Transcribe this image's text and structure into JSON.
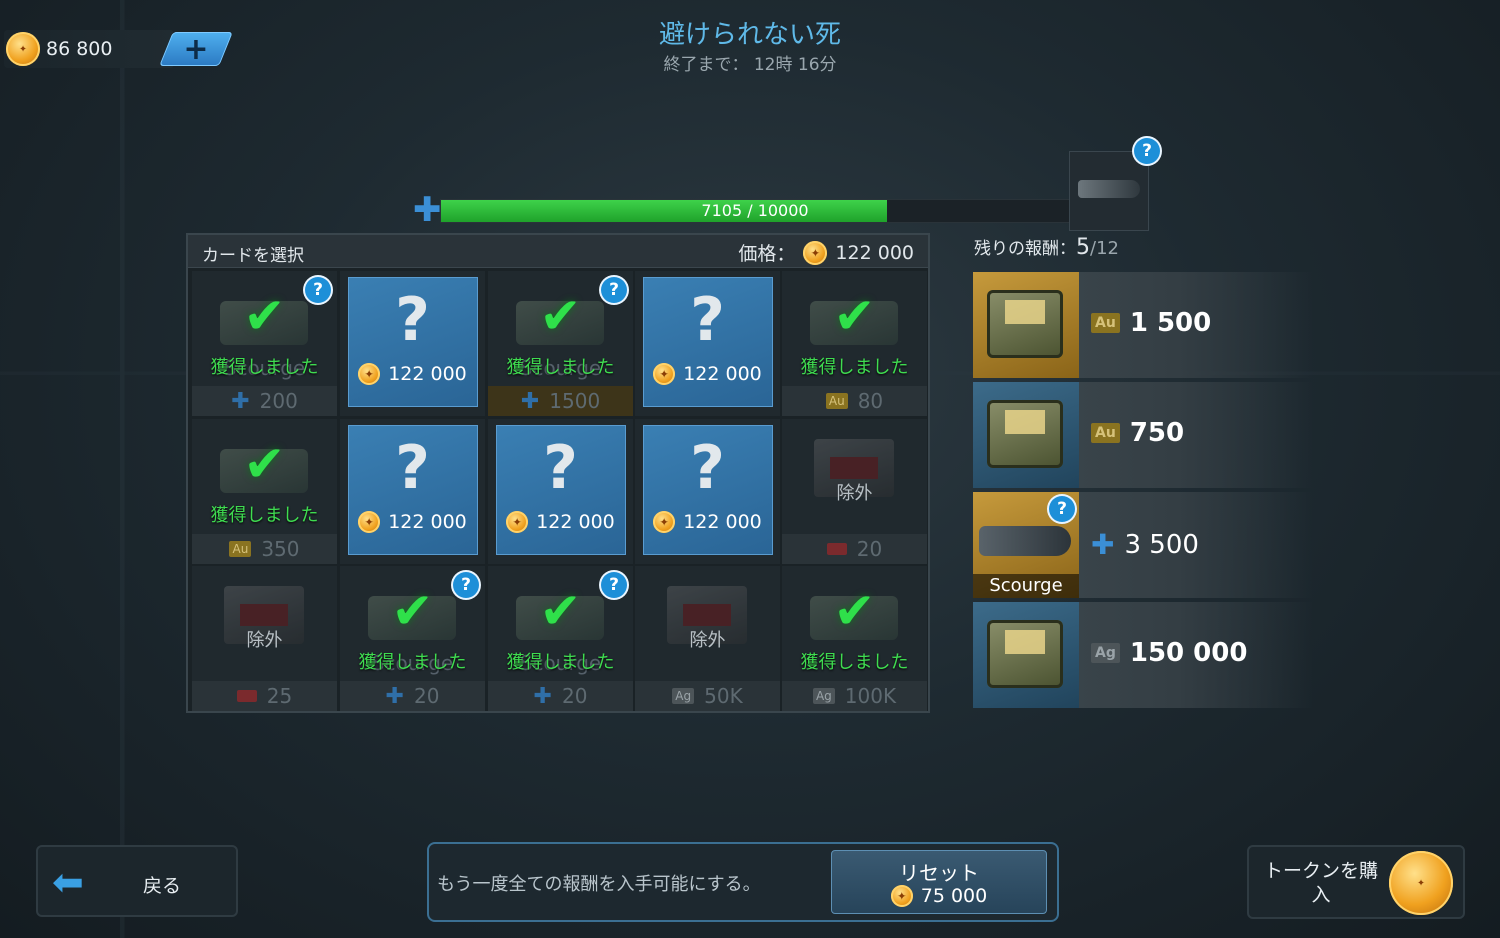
{
  "header": {
    "currency_amount": "86 800",
    "add_label": "+",
    "title": "避けられない死",
    "subtitle": "終了まで： 12時 16分"
  },
  "progress": {
    "text": "7105 / 10000",
    "value": 7105,
    "max": 10000
  },
  "panel": {
    "title": "カードを選択",
    "price_label": "価格：",
    "price_value": "122 000"
  },
  "cards": [
    {
      "state": "got",
      "got_label": "獲得しました",
      "ghost": "Scourge",
      "foot": "200",
      "foot_icon": "puzzle",
      "help": true
    },
    {
      "state": "mystery",
      "price": "122 000"
    },
    {
      "state": "got",
      "got_label": "獲得しました",
      "ghost": "Scourge",
      "foot": "1500",
      "foot_icon": "puzzle",
      "help": true,
      "gold": true
    },
    {
      "state": "mystery",
      "price": "122 000"
    },
    {
      "state": "got",
      "got_label": "獲得しました",
      "ghost": "",
      "foot": "80",
      "foot_icon": "Au"
    },
    {
      "state": "got",
      "got_label": "獲得しました",
      "ghost": "",
      "foot": "350",
      "foot_icon": "Au"
    },
    {
      "state": "mystery",
      "price": "122 000"
    },
    {
      "state": "mystery",
      "price": "122 000"
    },
    {
      "state": "mystery",
      "price": "122 000"
    },
    {
      "state": "excluded",
      "excl_label": "除外",
      "foot": "20",
      "foot_icon": "key"
    },
    {
      "state": "excluded",
      "excl_label": "除外",
      "foot": "25",
      "foot_icon": "key"
    },
    {
      "state": "got",
      "got_label": "獲得しました",
      "ghost": "Scourge",
      "foot": "20",
      "foot_icon": "puzzle",
      "help": true
    },
    {
      "state": "got",
      "got_label": "獲得しました",
      "ghost": "Scourge",
      "foot": "20",
      "foot_icon": "puzzle",
      "help": true
    },
    {
      "state": "excluded",
      "excl_label": "除外",
      "foot": "50K",
      "foot_icon": "Ag"
    },
    {
      "state": "got",
      "got_label": "獲得しました",
      "ghost": "",
      "foot": "100K",
      "foot_icon": "Ag"
    }
  ],
  "rewards": {
    "remaining_label": "残りの報酬：",
    "remaining": "5",
    "total": "/12",
    "items": [
      {
        "icon": "Au",
        "value": "1 500",
        "thumb": "gold"
      },
      {
        "icon": "Au",
        "value": "750",
        "thumb": "blue"
      },
      {
        "icon": "puzzle",
        "value": "3 500",
        "thumb": "gold",
        "tag": "Scourge",
        "help": true
      },
      {
        "icon": "Ag",
        "value": "150 000",
        "thumb": "blue"
      }
    ]
  },
  "footer": {
    "back_label": "戻る",
    "reset_message": "もう一度全ての報酬を入手可能にする。",
    "reset_label": "リセット",
    "reset_cost": "75 000",
    "buy_label": "トークンを購入"
  },
  "colors": {
    "accent": "#3aa0e4",
    "got": "#3fdc50",
    "progress": "#2fbf3b",
    "title": "#5fb9e8"
  }
}
